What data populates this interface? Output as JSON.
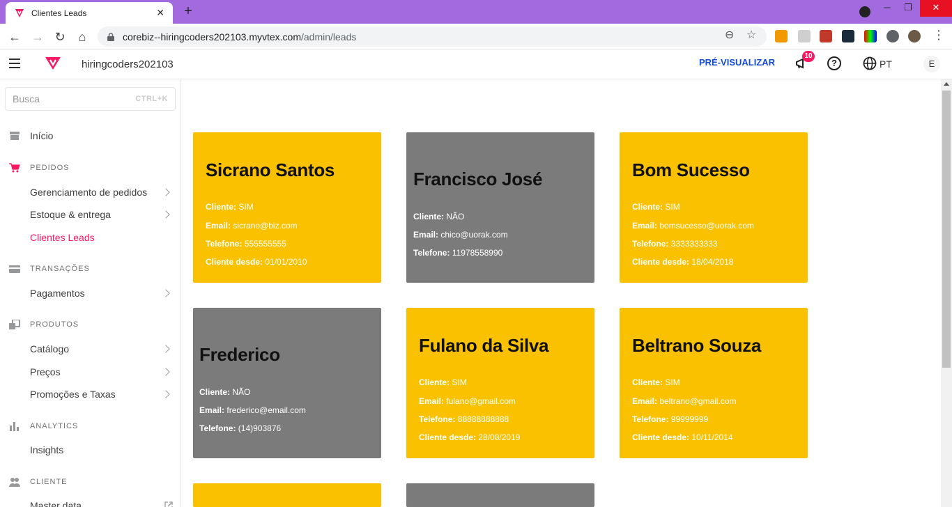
{
  "browser": {
    "tab_title": "Clientes Leads",
    "tab_close": "✕",
    "new_tab": "+",
    "url_domain": "corebiz--hiringcoders202103.myvtex.com",
    "url_path": "/admin/leads",
    "window_min": "─",
    "window_max": "❐",
    "window_close": "✕"
  },
  "topbar": {
    "account": "hiringcoders202103",
    "preview": "PRÉ-VISUALIZAR",
    "notification_count": "10",
    "help": "?",
    "language": "PT",
    "user_initial": "E"
  },
  "sidebar": {
    "search_placeholder": "Busca",
    "search_shortcut": "CTRL+K",
    "home": "Início",
    "sections": {
      "pedidos": "PEDIDOS",
      "transacoes": "TRANSAÇÕES",
      "produtos": "PRODUTOS",
      "analytics": "ANALYTICS",
      "cliente": "CLIENTE"
    },
    "items": {
      "gerenciamento": "Gerenciamento de pedidos",
      "estoque": "Estoque & entrega",
      "clientes_leads": "Clientes Leads",
      "pagamentos": "Pagamentos",
      "catalogo": "Catálogo",
      "precos": "Preços",
      "promocoes": "Promoções e Taxas",
      "insights": "Insights",
      "master_data": "Master data"
    }
  },
  "labels": {
    "cliente": "Cliente:",
    "email": "Email:",
    "telefone": "Telefone:",
    "cliente_desde": "Cliente desde:"
  },
  "cards": [
    {
      "name": "Sicrano Santos",
      "cliente": "SIM",
      "email": "sicrano@biz.com",
      "telefone": "555555555",
      "desde": "01/01/2010",
      "color": "#f9c100"
    },
    {
      "name": "Francisco José",
      "cliente": "NÃO",
      "email": "chico@uorak.com",
      "telefone": "11978558990",
      "color": "#7b7b7b"
    },
    {
      "name": "Bom Sucesso",
      "cliente": "SIM",
      "email": "bomsucesso@uorak.com",
      "telefone": "3333333333",
      "desde": "18/04/2018",
      "color": "#f9c100"
    },
    {
      "name": "Frederico",
      "cliente": "NÃO",
      "email": "frederico@email.com",
      "telefone": "(14)903876",
      "color": "#7b7b7b"
    },
    {
      "name": "Fulano da Silva",
      "cliente": "SIM",
      "email": "fulano@gmail.com",
      "telefone": "88888888888",
      "desde": "28/08/2019",
      "color": "#f9c100"
    },
    {
      "name": "Beltrano Souza",
      "cliente": "SIM",
      "email": "beltrano@gmail.com",
      "telefone": "99999999",
      "desde": "10/11/2014",
      "color": "#f9c100"
    }
  ],
  "colors": {
    "accent": "#f71963",
    "link_blue": "#134cd8",
    "card_yellow": "#f9c100",
    "card_gray": "#7b7b7b",
    "browser_frame": "#a36ae0"
  }
}
